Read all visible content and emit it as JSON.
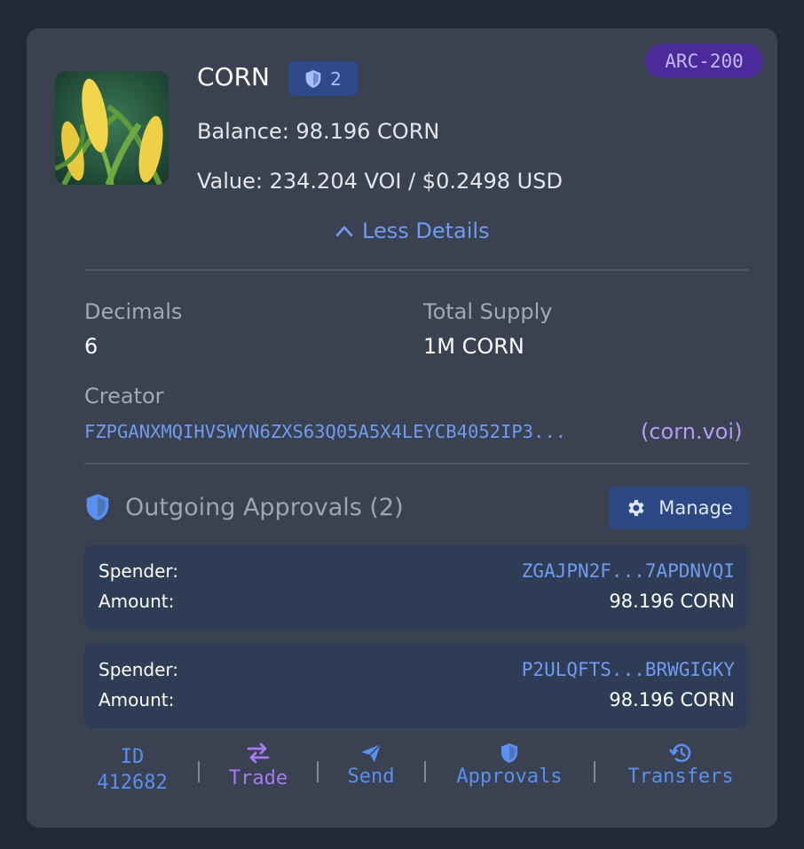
{
  "token": {
    "name": "CORN",
    "standard": "ARC-200",
    "approval_count": "2",
    "balance": "Balance: 98.196 CORN",
    "value": "Value: 234.204 VOI / $0.2498 USD"
  },
  "details": {
    "toggle_label": "Less Details",
    "decimals_label": "Decimals",
    "decimals_value": "6",
    "supply_label": "Total Supply",
    "supply_value": "1M CORN",
    "creator_label": "Creator",
    "creator_address": "FZPGANXMQIHVSWYN6ZXS63Q05A5X4LEYCB4052IP3...",
    "creator_name": "(corn.voi)"
  },
  "approvals": {
    "title": "Outgoing Approvals (2)",
    "manage_label": "Manage",
    "spender_label": "Spender:",
    "amount_label": "Amount:",
    "items": [
      {
        "spender": "ZGAJPN2F...7APDNVQI",
        "amount": "98.196 CORN"
      },
      {
        "spender": "P2ULQFTS...BRWGIGKY",
        "amount": "98.196 CORN"
      }
    ]
  },
  "footer": {
    "id_label": "ID",
    "id_value": "412682",
    "trade": "Trade",
    "send": "Send",
    "approvals": "Approvals",
    "transfers": "Transfers"
  },
  "icons": {
    "shield": "shield-icon",
    "chevron": "chevron-up-icon",
    "gear": "gear-icon",
    "trade": "swap-arrows-icon",
    "send": "paper-plane-icon",
    "history": "history-icon"
  },
  "colors": {
    "card": "#3a4151",
    "accent": "#6f9bf0",
    "trade": "#a57af2",
    "standard_badge": "#4b2a9a"
  }
}
